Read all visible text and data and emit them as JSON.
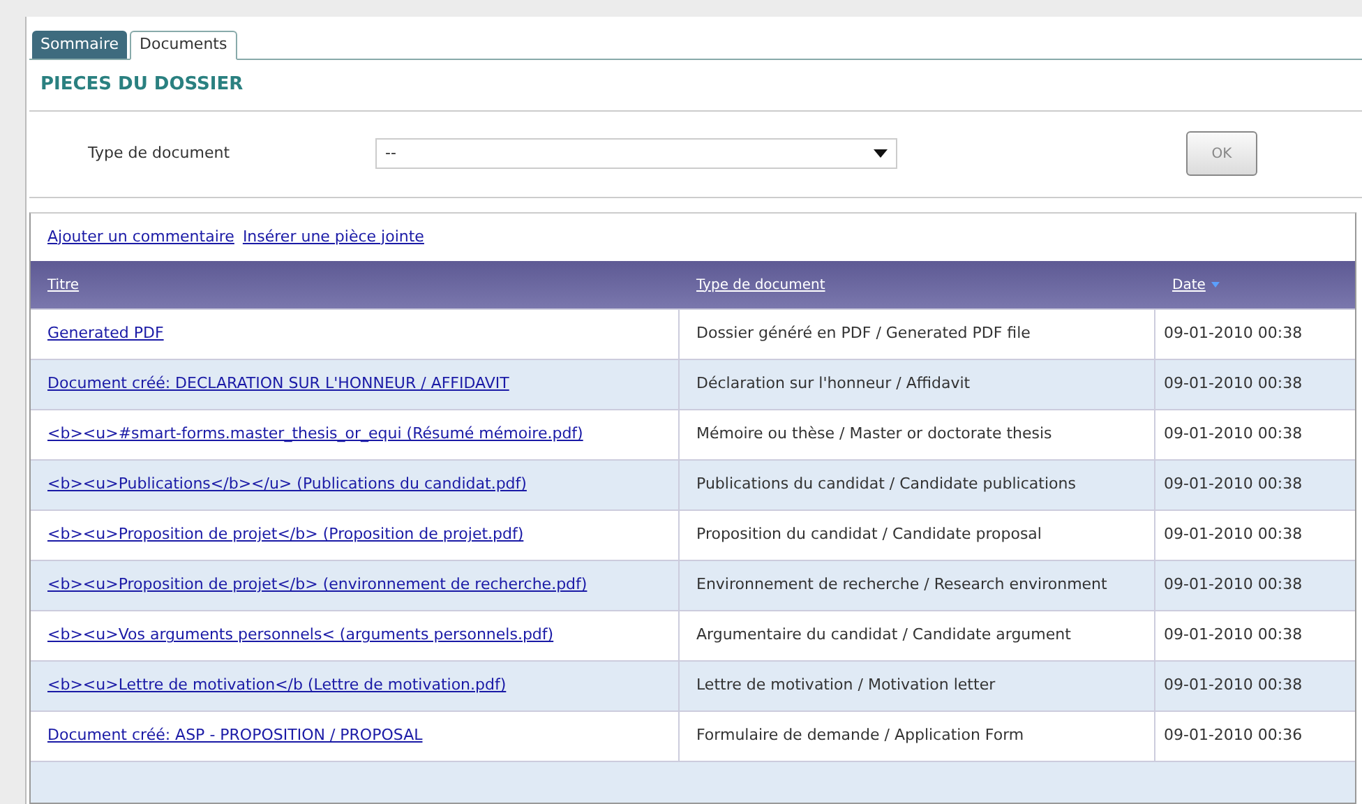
{
  "tabs": [
    {
      "label": "Sommaire",
      "selected": false
    },
    {
      "label": "Documents",
      "selected": true
    }
  ],
  "heading": "PIECES DU DOSSIER",
  "filter": {
    "label": "Type de document",
    "value": "--",
    "button": "OK"
  },
  "actions": [
    "Ajouter un commentaire",
    "Insérer une pièce jointe"
  ],
  "table": {
    "columns": [
      {
        "label": "Titre",
        "sorted": false
      },
      {
        "label": "Type de document",
        "sorted": false
      },
      {
        "label": "Date",
        "sorted": true
      }
    ],
    "rows": [
      {
        "title": "Generated PDF",
        "type": "Dossier généré en PDF / Generated PDF file",
        "date": "09-01-2010 00:38"
      },
      {
        "title": "Document créé: DECLARATION SUR L'HONNEUR / AFFIDAVIT",
        "type": "Déclaration sur l'honneur / Affidavit",
        "date": "09-01-2010 00:38"
      },
      {
        "title": "<b><u>#smart-forms.master_thesis_or_equi (Résumé mémoire.pdf)",
        "type": "Mémoire ou thèse / Master or doctorate thesis",
        "date": "09-01-2010 00:38"
      },
      {
        "title": "<b><u>Publications</b></u> (Publications du candidat.pdf)",
        "type": "Publications du candidat / Candidate publications",
        "date": "09-01-2010 00:38"
      },
      {
        "title": "<b><u>Proposition de projet</b> (Proposition de projet.pdf)",
        "type": "Proposition du candidat / Candidate proposal",
        "date": "09-01-2010 00:38"
      },
      {
        "title": "<b><u>Proposition de projet</b> (environnement de recherche.pdf)",
        "type": "Environnement de recherche / Research environment",
        "date": "09-01-2010 00:38"
      },
      {
        "title": "<b><u>Vos arguments personnels< (arguments personnels.pdf)",
        "type": "Argumentaire du candidat / Candidate argument",
        "date": "09-01-2010 00:38"
      },
      {
        "title": "<b><u>Lettre de motivation</b (Lettre de motivation.pdf)",
        "type": "Lettre de motivation / Motivation letter",
        "date": "09-01-2010 00:38"
      },
      {
        "title": "Document créé: ASP - PROPOSITION / PROPOSAL",
        "type": "Formulaire de demande / Application Form",
        "date": "09-01-2010 00:36"
      }
    ]
  }
}
